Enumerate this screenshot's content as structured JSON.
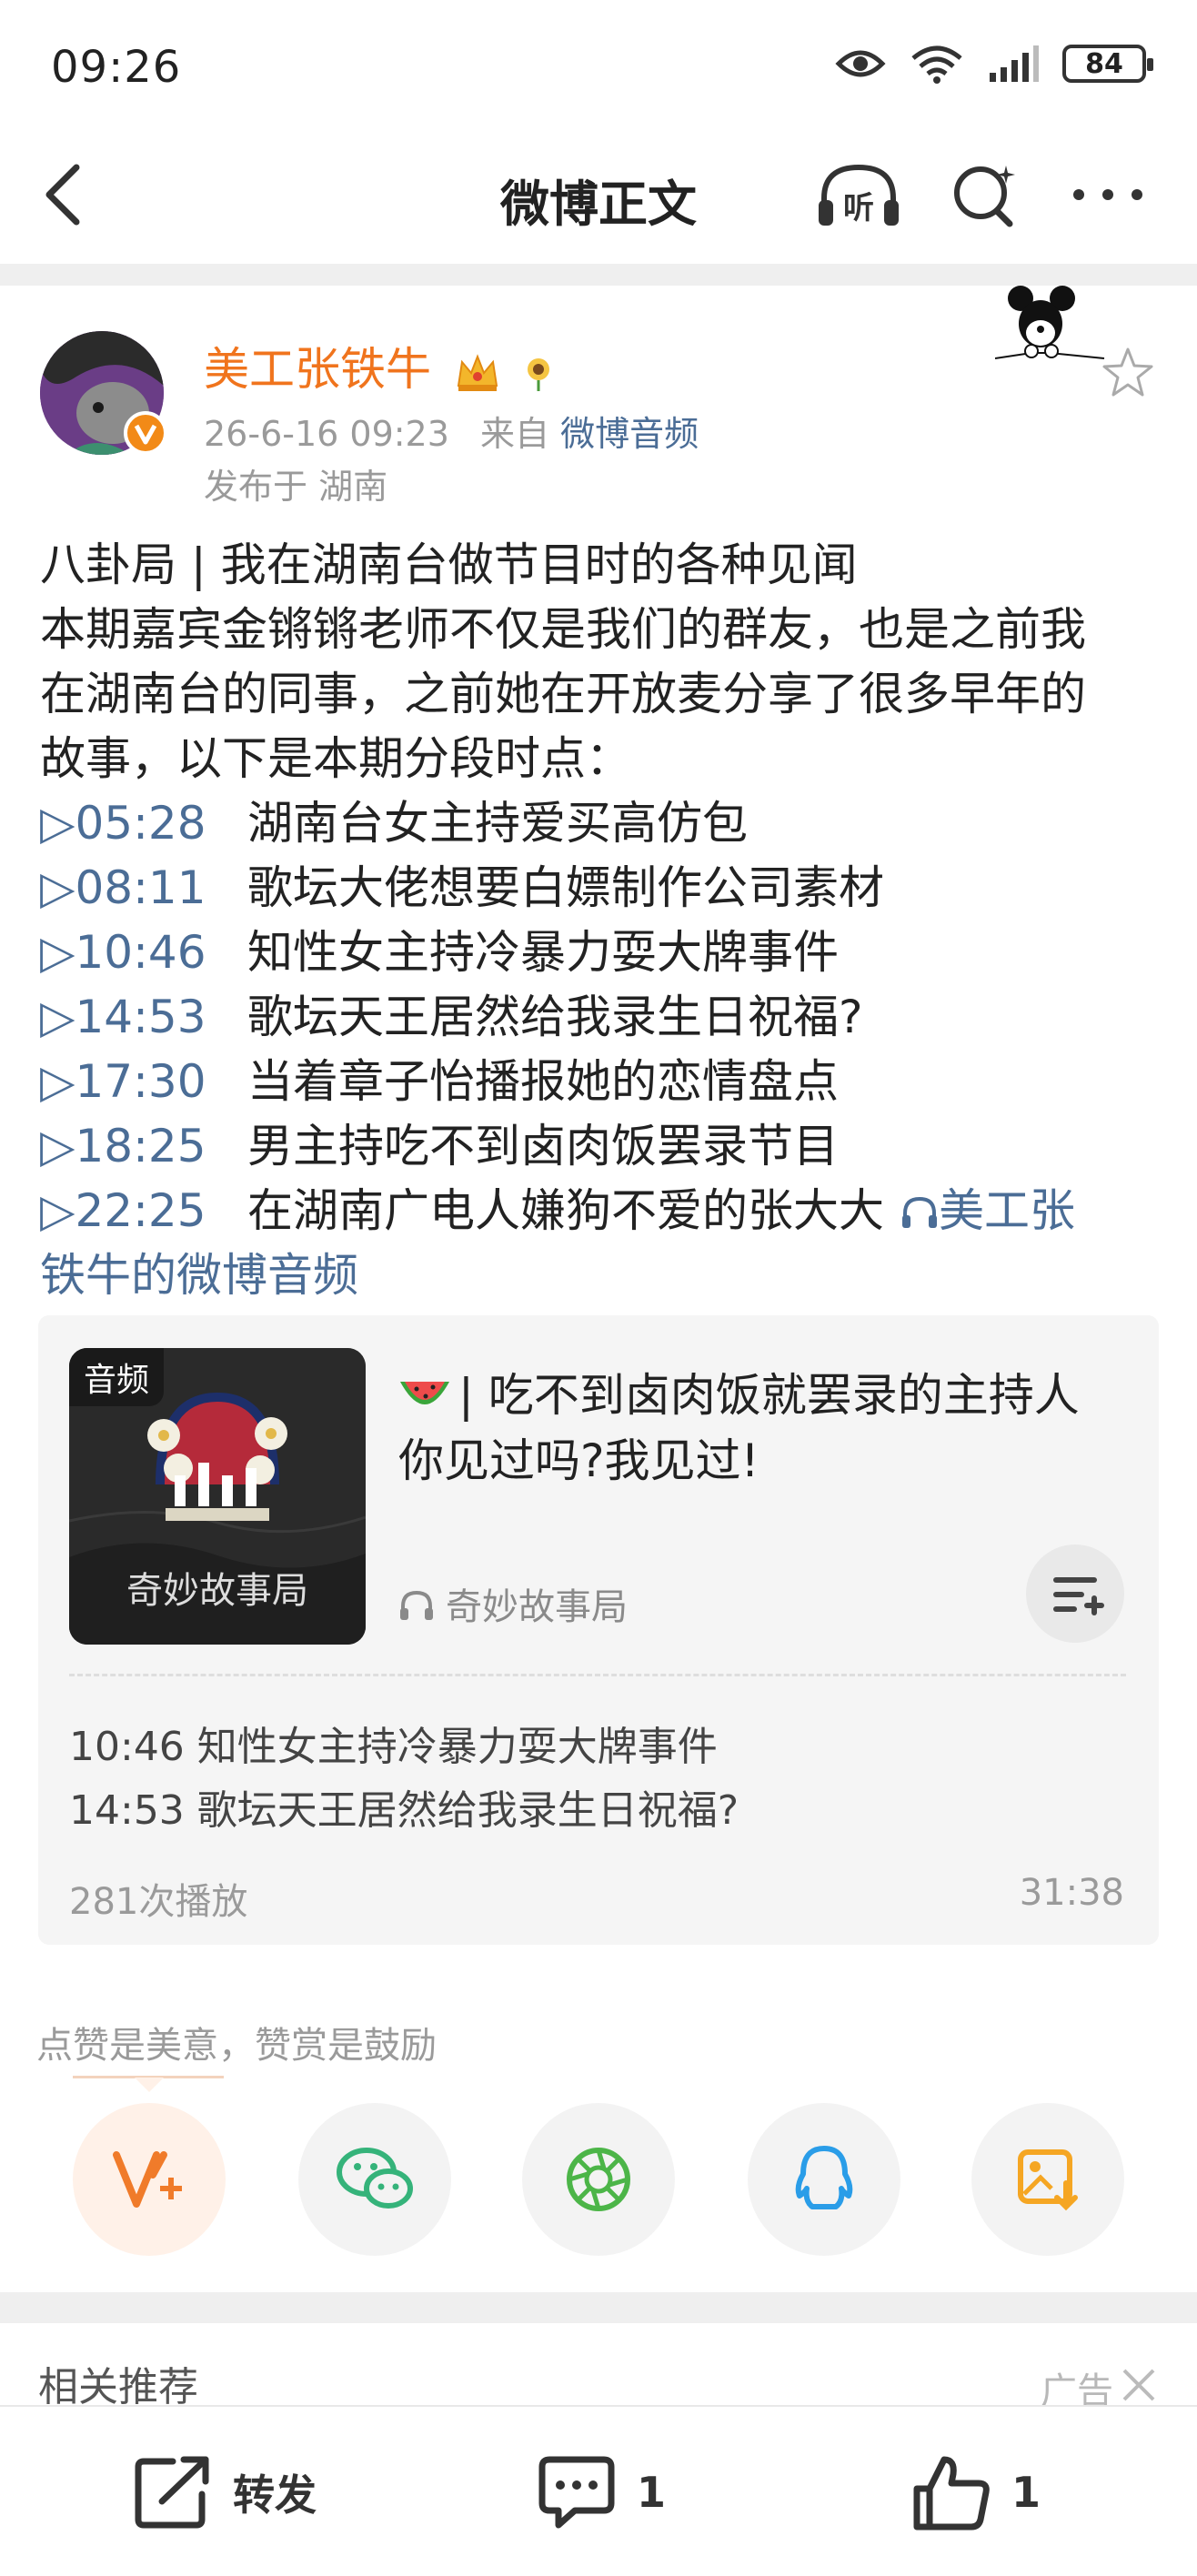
{
  "status_bar": {
    "time": "09:26",
    "battery": "84"
  },
  "nav": {
    "title": "微博正文",
    "icons": [
      "back-icon",
      "listen-icon",
      "search-icon",
      "more-icon"
    ],
    "listen_label": "听"
  },
  "post": {
    "author": {
      "name": "美工张铁牛",
      "time": "26-6-16 09:23",
      "from_prefix": "来自",
      "source": "微博音频",
      "location": "发布于 湖南"
    },
    "text_lines": [
      "八卦局 | 我在湖南台做节目时的各种见闻",
      "本期嘉宾金锵锵老师不仅是我们的群友，也是之前我",
      "在湖南台的同事，之前她在开放麦分享了很多早年的",
      "故事，以下是本期分段时点："
    ],
    "timestamps": [
      {
        "time": "▷05:28",
        "text": "湖南台女主持爱买高仿包"
      },
      {
        "time": "▷08:11",
        "text": "歌坛大佬想要白嫖制作公司素材"
      },
      {
        "time": "▷10:46",
        "text": "知性女主持冷暴力耍大牌事件"
      },
      {
        "time": "▷14:53",
        "text": "歌坛天王居然给我录生日祝福?"
      },
      {
        "time": "▷17:30",
        "text": "当着章子怡播报她的恋情盘点"
      },
      {
        "time": "▷18:25",
        "text": "男主持吃不到卤肉饭罢录节目"
      },
      {
        "time": "▷22:25",
        "text": "在湖南广电人嫌狗不爱的张大大"
      }
    ],
    "audio_link_part1": "美工张",
    "audio_link_part2": "铁牛的微博音频"
  },
  "audio_card": {
    "tag": "音频",
    "cover_name": "奇妙故事局",
    "title_line1": "| 吃不到卤肉饭就罢录的主持人",
    "title_line2": "你见过吗?我见过!",
    "channel": "奇妙故事局",
    "chapters": [
      "10:46 知性女主持冷暴力耍大牌事件",
      "14:53 歌坛天王居然给我录生日祝福?"
    ],
    "plays": "281次播放",
    "duration": "31:38"
  },
  "reward": {
    "text": "点赞是美意，赞赏是鼓励",
    "share_targets": [
      "reward-icon",
      "wechat-icon",
      "moments-icon",
      "qq-icon",
      "save-image-icon"
    ]
  },
  "related": {
    "title": "相关推荐",
    "ad_label": "广告"
  },
  "actions": {
    "repost": "转发",
    "comments": "1",
    "likes": "1"
  },
  "colors": {
    "name": "#f0741d",
    "link": "#4b6d96",
    "meta": "#9a9a9a",
    "badge": "#f28a17"
  }
}
